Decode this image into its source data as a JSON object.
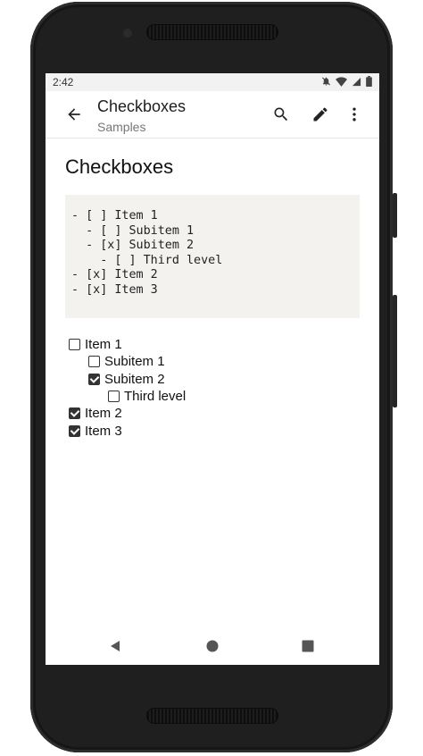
{
  "status_bar": {
    "time": "2:42",
    "icons": [
      "notifications-off-icon",
      "wifi-icon",
      "cellular-icon",
      "battery-icon"
    ]
  },
  "app_bar": {
    "title": "Checkboxes",
    "subtitle": "Samples",
    "back_icon": "arrow-back-icon",
    "actions": [
      "search-icon",
      "edit-pencil-icon",
      "more-vert-icon"
    ]
  },
  "content": {
    "heading": "Checkboxes",
    "code_lines": [
      "- [ ] Item 1",
      "  - [ ] Subitem 1",
      "  - [x] Subitem 2",
      "    - [ ] Third level",
      "- [x] Item 2",
      "- [x] Item 3"
    ],
    "checklist": [
      {
        "label": "Item 1",
        "checked": false,
        "level": 0
      },
      {
        "label": "Subitem 1",
        "checked": false,
        "level": 1
      },
      {
        "label": "Subitem 2",
        "checked": true,
        "level": 1
      },
      {
        "label": "Third level",
        "checked": false,
        "level": 2
      },
      {
        "label": "Item 2",
        "checked": true,
        "level": 0
      },
      {
        "label": "Item 3",
        "checked": true,
        "level": 0
      }
    ]
  },
  "nav_bar": {
    "icons": [
      "nav-back-icon",
      "nav-home-icon",
      "nav-recents-icon"
    ]
  },
  "colors": {
    "code_background": "#f4f2ef",
    "appbar_background": "#ffffff",
    "statusbar_background": "#f2f2f2",
    "phone_frame": "#1f1f1f"
  }
}
